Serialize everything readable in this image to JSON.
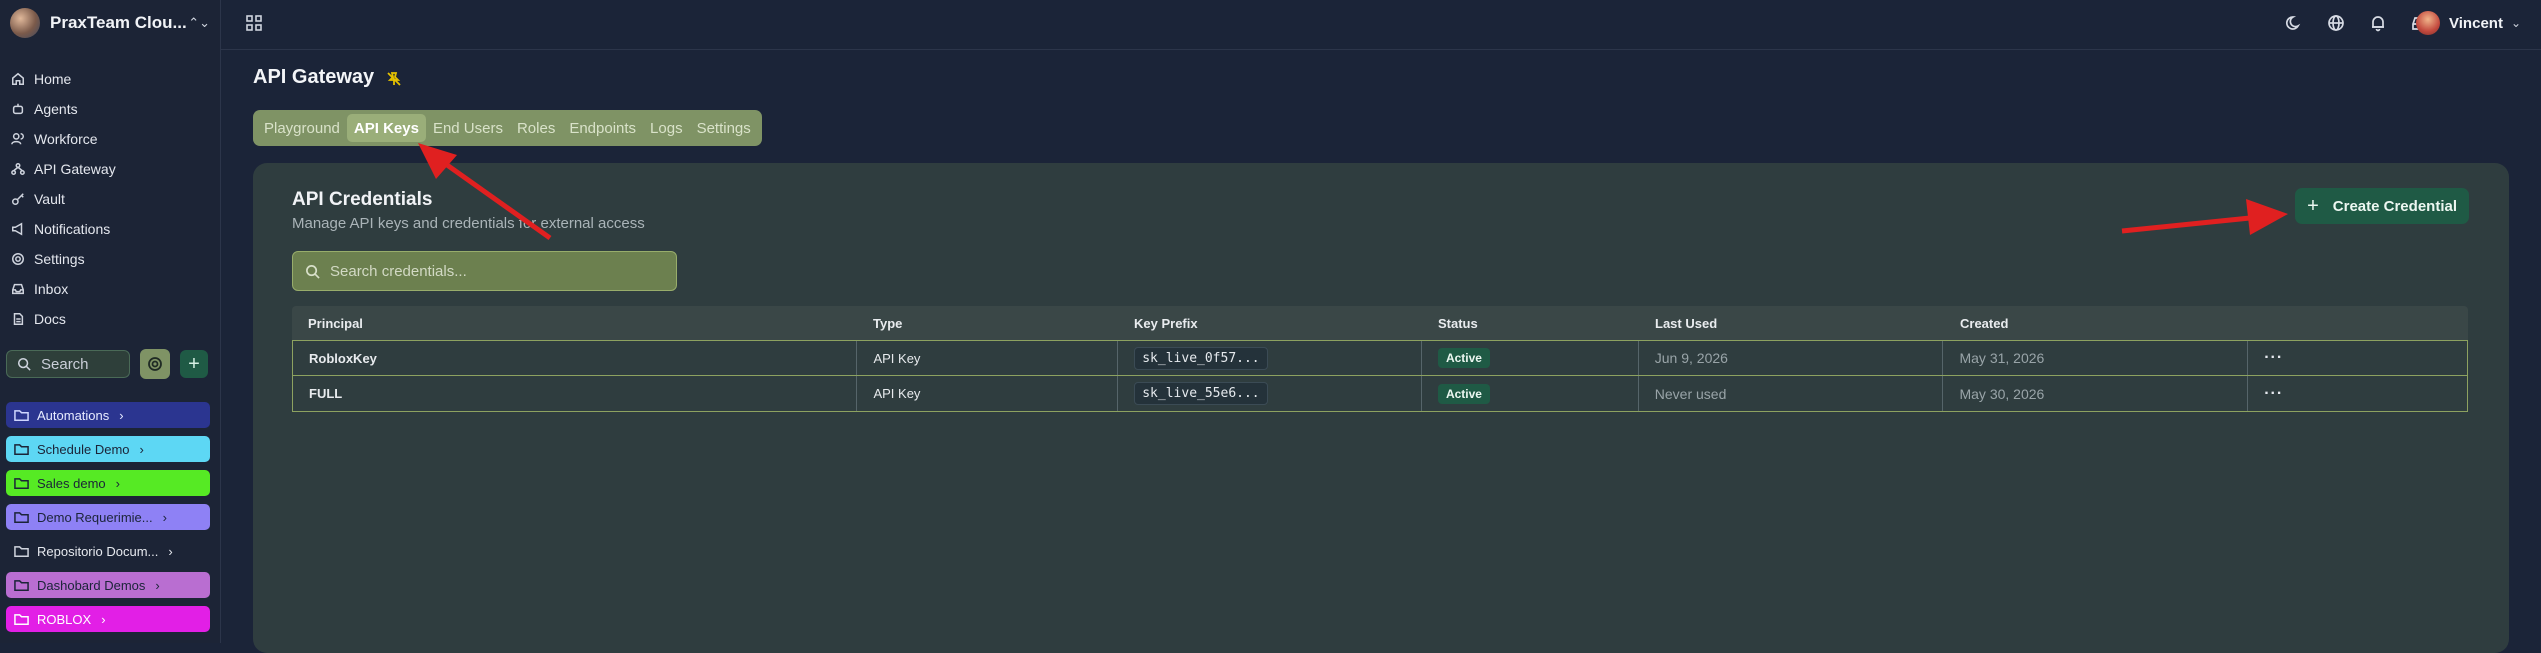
{
  "workspace": {
    "name": "PraxTeam Clou..."
  },
  "nav": [
    {
      "label": "Home",
      "icon": "home-icon"
    },
    {
      "label": "Agents",
      "icon": "bot-icon"
    },
    {
      "label": "Workforce",
      "icon": "users-icon"
    },
    {
      "label": "API Gateway",
      "icon": "gateway-icon"
    },
    {
      "label": "Vault",
      "icon": "key-icon"
    },
    {
      "label": "Notifications",
      "icon": "megaphone-icon"
    },
    {
      "label": "Settings",
      "icon": "gear-icon"
    },
    {
      "label": "Inbox",
      "icon": "inbox-icon"
    },
    {
      "label": "Docs",
      "icon": "doc-icon"
    }
  ],
  "sidebar_search": {
    "placeholder": "Search"
  },
  "folders": [
    {
      "label": "Automations",
      "color": "#2b3590"
    },
    {
      "label": "Schedule Demo",
      "color": "#5dd7f4"
    },
    {
      "label": "Sales demo",
      "color": "#56ea24"
    },
    {
      "label": "Demo Requerimie...",
      "color": "#8e81f5"
    },
    {
      "label": "Repositorio Docum...",
      "color": "transparent"
    },
    {
      "label": "Dashobard Demos",
      "color": "#b96ed1"
    },
    {
      "label": "ROBLOX",
      "color": "#e21fe6"
    }
  ],
  "topbar": {
    "user_name": "Vincent"
  },
  "page": {
    "title": "API Gateway"
  },
  "tabs": [
    {
      "label": "Playground",
      "active": false
    },
    {
      "label": "API Keys",
      "active": true
    },
    {
      "label": "End Users",
      "active": false
    },
    {
      "label": "Roles",
      "active": false
    },
    {
      "label": "Endpoints",
      "active": false
    },
    {
      "label": "Logs",
      "active": false
    },
    {
      "label": "Settings",
      "active": false
    }
  ],
  "credentials": {
    "title": "API Credentials",
    "subtitle": "Manage API keys and credentials for external access",
    "create_label": "Create Credential",
    "search_placeholder": "Search credentials...",
    "columns": [
      "Principal",
      "Type",
      "Key Prefix",
      "Status",
      "Last Used",
      "Created"
    ],
    "rows": [
      {
        "principal": "RobloxKey",
        "type": "API Key",
        "key_prefix": "sk_live_0f57...",
        "status": "Active",
        "last_used": "Jun 9, 2026",
        "created": "May 31, 2026"
      },
      {
        "principal": "FULL",
        "type": "API Key",
        "key_prefix": "sk_live_55e6...",
        "status": "Active",
        "last_used": "Never used",
        "created": "May 30, 2026"
      }
    ]
  },
  "colors": {
    "accent_green": "#1f5a45",
    "tab_bar": "#7f9365",
    "annotation_arrow": "#e02020"
  }
}
